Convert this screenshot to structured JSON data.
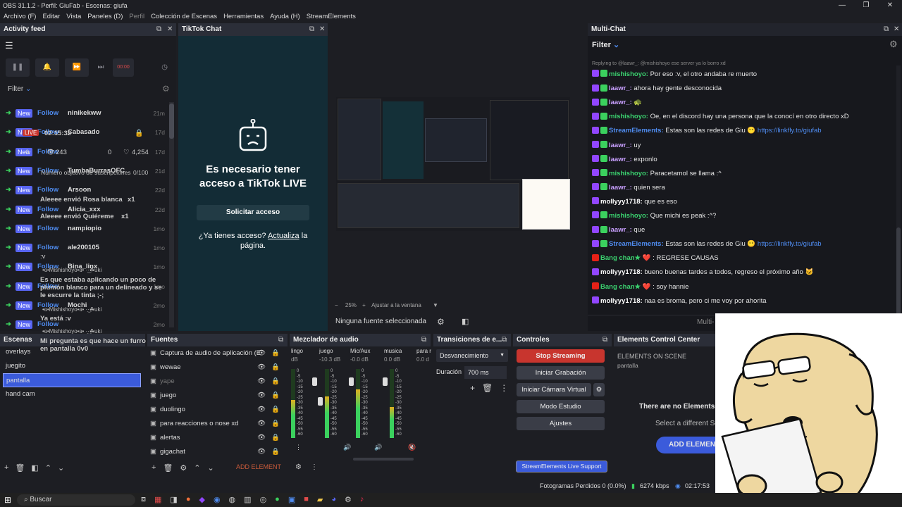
{
  "window": {
    "title": "OBS 31.1.2 - Perfil: GiuFab - Escenas: giufa",
    "controls": [
      "—",
      "❐",
      "✕"
    ]
  },
  "menu": [
    "Archivo (F)",
    "Editar",
    "Vista",
    "Paneles (D)",
    "Perfil",
    "Colección de Escenas",
    "Herramientas",
    "Ayuda (H)",
    "StreamElements"
  ],
  "activity_feed": {
    "title": "Activity feed",
    "filter_label": "Filter",
    "rec_time": "00:00",
    "rows": [
      {
        "badge": "New",
        "type": "Follow",
        "name": "ninikekww",
        "time": "21m"
      },
      {
        "badge": "New",
        "type": "Follow",
        "name": "Cabasado",
        "time": "17d"
      },
      {
        "badge": "New",
        "type": "Follow",
        "name": "",
        "time": "17d"
      },
      {
        "badge": "New",
        "type": "Follow",
        "name": "TumbaBurrasOFC",
        "time": "21d"
      },
      {
        "badge": "New",
        "type": "Follow",
        "name": "Arsoon",
        "time": "22d"
      },
      {
        "badge": "New",
        "type": "Follow",
        "name": "Alicia_xxx",
        "time": "22d"
      },
      {
        "badge": "New",
        "type": "Follow",
        "name": "nampiopio",
        "time": "1mo"
      },
      {
        "badge": "New",
        "type": "Follow",
        "name": "ale200105",
        "time": "1mo"
      },
      {
        "badge": "New",
        "type": "Follow",
        "name": "Bina_linx",
        "time": "1mo"
      },
      {
        "badge": "New",
        "type": "Follow",
        "name": "",
        "time": "1mo"
      },
      {
        "badge": "New",
        "type": "Follow",
        "name": "Mochi",
        "time": "2mo"
      },
      {
        "badge": "New",
        "type": "Follow",
        "name": "",
        "time": "2mo"
      }
    ],
    "overlay": {
      "live_badge": "LIVE",
      "live_time": "02:15:32",
      "viewers": "0",
      "views": "243",
      "hearts": "0",
      "likes": "4,254",
      "goal_text": "Número objetivo de suscripciones",
      "goal_value": "0/100",
      "gift1": "Aleeee envió Rosa blanca",
      "gift1_count": "x1",
      "gift2": "Aleeee envió Quiéreme",
      "gift2_count": "x1",
      "chat1": ":v",
      "chat2_user": "•ɞ•Mishishoyo•ɞ• ·͜·☘uki",
      "chat2": "Es que estaba aplicando un poco de plumón blanco para un delineado y se le escurre la tinta ;-;",
      "chat3_user": "•ɞ•Mishishoyo•ɞ• ·͜·☘uki",
      "chat3": "Ya está :v",
      "chat4_user": "•ɞ•Mishishoyo•ɞ• ·͜·☘uki",
      "chat4": "Mi pregunta es que hace un furro en pantalla 0v0"
    }
  },
  "tiktok": {
    "title": "TikTok Chat",
    "heading": "Es necesario tener acceso a TikTok LIVE",
    "button": "Solicitar acceso",
    "question": "¿Ya tienes acceso?",
    "link": "Actualiza",
    "tail": "la página."
  },
  "preview": {
    "zoom": "25%",
    "fit": "Ajustar a la ventana",
    "no_source": "Ninguna fuente seleccionada"
  },
  "multichat": {
    "title": "Multi-Chat",
    "filter": "Filter",
    "reply_hint": "Replying to @laawr_: @mishishoyo ese server ya lo borro xd",
    "lines": [
      {
        "platform": "twitch",
        "user": "mishishoyo:",
        "color": "#3bd16f",
        "text": "Por eso :v, el otro andaba re muerto"
      },
      {
        "platform": "twitch",
        "user": "laawr_:",
        "color": "#c9a0ff",
        "text": "ahora hay gente desconocida"
      },
      {
        "platform": "twitch",
        "user": "laawr_:",
        "color": "#c9a0ff",
        "text": "🐢"
      },
      {
        "platform": "twitch",
        "user": "mishishoyo:",
        "color": "#3bd16f",
        "text": "Oe, en el discord hay una persona que la conocí en otro directo xD"
      },
      {
        "platform": "twitch",
        "user": "StreamElements:",
        "color": "#4f8cf0",
        "text": "Estas son las redes de Giu 😶",
        "link": "https://linkfly.to/giufab"
      },
      {
        "platform": "twitch",
        "user": "laawr_:",
        "color": "#c9a0ff",
        "text": "uy"
      },
      {
        "platform": "twitch",
        "user": "laawr_:",
        "color": "#c9a0ff",
        "text": "exponlo"
      },
      {
        "platform": "twitch",
        "user": "mishishoyo:",
        "color": "#3bd16f",
        "text": "Paracetamol se llama :^"
      },
      {
        "platform": "twitch",
        "user": "laawr_:",
        "color": "#c9a0ff",
        "text": "quien sera"
      },
      {
        "platform": "twitch",
        "user": "mollyyy1718:",
        "color": "#ffffff",
        "text": "que es eso"
      },
      {
        "platform": "twitch",
        "user": "mishishoyo:",
        "color": "#3bd16f",
        "text": "Que michi es peak :^?"
      },
      {
        "platform": "twitch",
        "user": "laawr_:",
        "color": "#c9a0ff",
        "text": "que"
      },
      {
        "platform": "twitch",
        "user": "StreamElements:",
        "color": "#4f8cf0",
        "text": "Estas son las redes de Giu 😶",
        "link": "https://linkfly.to/giufab"
      },
      {
        "platform": "youtube",
        "user": "Bang chan★ ❤️",
        "color": "#3bd16f",
        "text": ": REGRESE CAUSAS"
      },
      {
        "platform": "twitch",
        "user": "mollyyy1718:",
        "color": "#ffffff",
        "text": "bueno buenas tardes a todos, regreso el próximo año 🐱"
      },
      {
        "platform": "youtube",
        "user": "Bang chan★ ❤️",
        "color": "#3bd16f",
        "text": ": soy hannie"
      },
      {
        "platform": "twitch",
        "user": "mollyyy1718:",
        "color": "#ffffff",
        "text": "naa es broma, pero ci me voy por ahorita"
      }
    ],
    "input_placeholder": "Multi-"
  },
  "scenes": {
    "title": "Escenas",
    "items": [
      "overlays",
      "juegito",
      "pantalla",
      "hand cam"
    ],
    "selected": "pantalla"
  },
  "sources": {
    "title": "Fuentes",
    "items": [
      "Captura de audio de aplicación (E",
      "wewae",
      "yape",
      "juego",
      "duolingo",
      "para reacciones o nose xd",
      "alertas",
      "gigachat"
    ],
    "add_element": "ADD ELEMENT"
  },
  "mixer": {
    "title": "Mezclador de audio",
    "channels": [
      {
        "name": "lingo",
        "db": "dB"
      },
      {
        "name": "juego",
        "db": "-10.3 dB"
      },
      {
        "name": "Mic/Aux",
        "db": "-0.0 dB"
      },
      {
        "name": "musica",
        "db": "0.0 dB"
      },
      {
        "name": "para r",
        "db": "0.0 d"
      }
    ],
    "scale": [
      "0",
      "-5",
      "-10",
      "-15",
      "-20",
      "-25",
      "-30",
      "-35",
      "-40",
      "-45",
      "-50",
      "-55",
      "-60"
    ]
  },
  "transitions": {
    "title": "Transiciones de e...",
    "type": "Desvanecimiento",
    "duration_label": "Duración",
    "duration_value": "700 ms"
  },
  "controls": {
    "title": "Controles",
    "stop_streaming": "Stop Streaming",
    "start_recording": "Iniciar Grabación",
    "start_vcam": "Iniciar Cámara Virtual",
    "studio_mode": "Modo Estudio",
    "settings": "Ajustes",
    "support": "StreamElements Live Support"
  },
  "ecc": {
    "title": "Elements Control Center",
    "subtitle": "ELEMENTS ON SCENE",
    "scene": "pantalla",
    "empty": "There are no Elements i",
    "hint": "Select a different Sc",
    "add": "ADD ELEMEN"
  },
  "status": {
    "dropped": "Fotogramas Perdidos 0 (0.0%)",
    "bitrate": "6274 kbps",
    "time": "02:17:53"
  },
  "taskbar": {
    "search": "Buscar"
  },
  "colors": {
    "accent_red": "#c8352e",
    "accent_blue": "#3b5bdb",
    "follow_blue": "#4f8cf0",
    "new_badge": "#5865f2",
    "arrow_green": "#3bd15e"
  }
}
